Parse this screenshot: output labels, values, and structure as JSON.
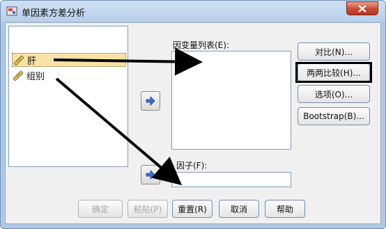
{
  "window": {
    "title": "单因素方差分析",
    "close_label": "close"
  },
  "variables": {
    "items": [
      {
        "label": "肝",
        "icon": "ruler-scale-icon",
        "selected": true
      },
      {
        "label": "组别",
        "icon": "ruler-scale-icon",
        "selected": false
      }
    ]
  },
  "dependent": {
    "label": "因变量列表(E):"
  },
  "factor": {
    "label": "因子(F):"
  },
  "side_buttons": {
    "contrasts": "对比(N)...",
    "post_hoc": "两两比较(H)...",
    "options": "选项(O)...",
    "bootstrap": "Bootstrap(B)..."
  },
  "bottom_buttons": {
    "ok": "确定",
    "paste": "粘贴(P)",
    "reset": "重置(R)",
    "cancel": "取消",
    "help": "帮助"
  },
  "colors": {
    "arrow_blue": "#3b6fd6",
    "selection": "#f7e3a6",
    "annotation": "#000000"
  }
}
